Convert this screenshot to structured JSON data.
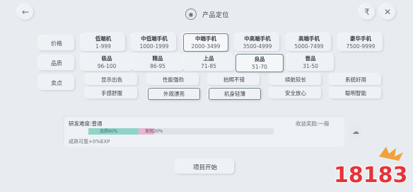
{
  "header": {
    "title": "产品定位"
  },
  "labels": {
    "price": "价格",
    "quality": "品质",
    "features": "卖点"
  },
  "price_options": [
    {
      "name": "低端机",
      "range": "1-999"
    },
    {
      "name": "中低端手机",
      "range": "1000-1999"
    },
    {
      "name": "中端手机",
      "range": "2000-3499"
    },
    {
      "name": "中高端手机",
      "range": "3500-4999"
    },
    {
      "name": "高端手机",
      "range": "5000-7499"
    },
    {
      "name": "豪华手机",
      "range": "7500-9999"
    }
  ],
  "quality_options": [
    {
      "name": "极品",
      "range": "96-100"
    },
    {
      "name": "精品",
      "range": "86-95"
    },
    {
      "name": "上品",
      "range": "71-85"
    },
    {
      "name": "良品",
      "range": "51-70"
    },
    {
      "name": "普品",
      "range": "31-50"
    }
  ],
  "features": [
    "显示出色",
    "性能强劲",
    "拍照不错",
    "续航较长",
    "系统好用",
    "手感舒服",
    "外观漂亮",
    "机身轻薄",
    "安全放心",
    "聪明智能"
  ],
  "info": {
    "difficulty": "研发难度:普通",
    "bonus": "收益奖励:一般",
    "bar_quality_label": "品质60%",
    "bar_beauty_label": "美观20%",
    "bar_quality_pct": 60,
    "bar_beauty_pct": 20,
    "exp": "成熟可靠+0%EXP"
  },
  "start_button": "项目开始",
  "watermark": "18183",
  "colors": {
    "quality_fill": "#8fd3c9",
    "beauty_fill": "#e7b6d2",
    "selected_border": "#6f8795"
  }
}
